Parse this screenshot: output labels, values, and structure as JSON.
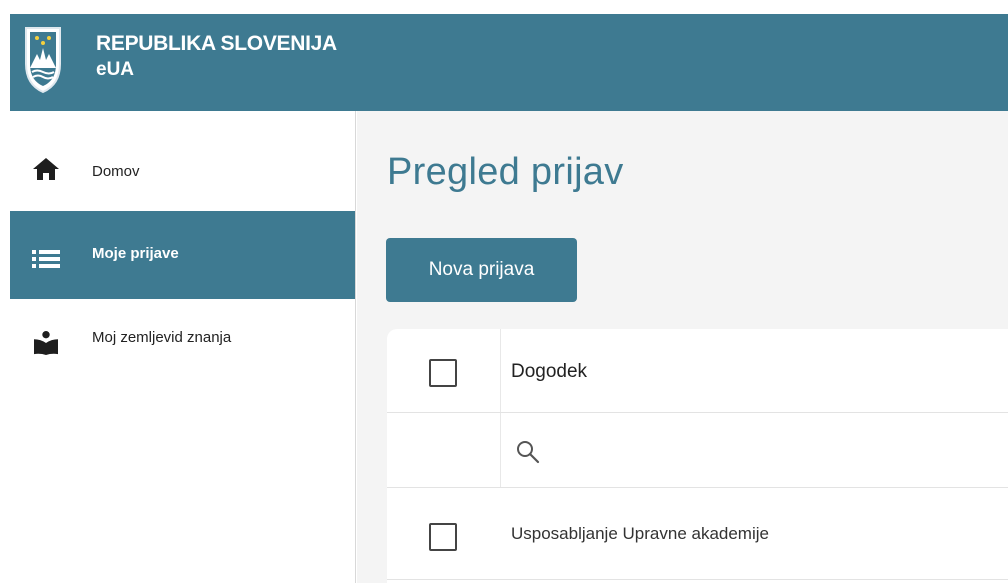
{
  "header": {
    "title": "REPUBLIKA SLOVENIJA",
    "subtitle": "eUA",
    "crest_icon": "coat-of-arms-icon",
    "bg_color": "#3e7a91"
  },
  "sidebar": {
    "items": [
      {
        "label": "Domov",
        "icon": "home-icon",
        "active": false
      },
      {
        "label": "Moje prijave",
        "icon": "list-icon",
        "active": true
      },
      {
        "label": "Moj zemljevid znanja",
        "icon": "reading-person-icon",
        "active": false
      }
    ]
  },
  "main": {
    "title": "Pregled prijav",
    "new_button_label": "Nova prijava",
    "table": {
      "column_header": "Dogodek",
      "search_placeholder": "",
      "rows": [
        {
          "event": "Usposabljanje Upravne akademije",
          "checked": false
        }
      ]
    }
  },
  "colors": {
    "accent": "#3e7a91",
    "content_bg": "#f4f4f4"
  }
}
